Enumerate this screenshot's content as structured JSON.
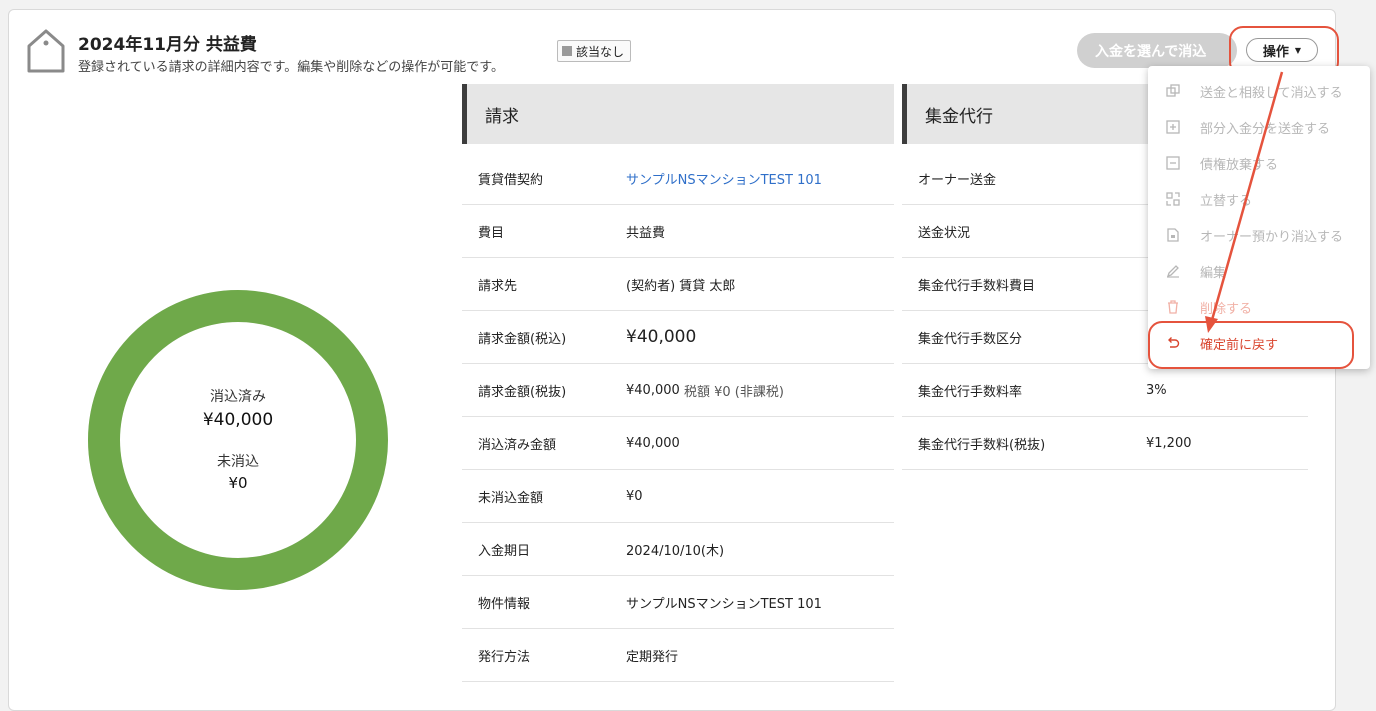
{
  "header": {
    "title": "2024年11月分 共益費",
    "subtitle": "登録されている請求の詳細内容です。編集や削除などの操作が可能です。",
    "badge": "該当なし",
    "pay_button": "入金を選んで消込",
    "operation_button": "操作"
  },
  "menu": {
    "items": [
      {
        "label": "送金と相殺して消込する",
        "icon": "offset-icon"
      },
      {
        "label": "部分入金分を送金する",
        "icon": "plus-square-icon"
      },
      {
        "label": "債権放棄する",
        "icon": "minus-square-icon"
      },
      {
        "label": "立替する",
        "icon": "advance-icon"
      },
      {
        "label": "オーナー預かり消込する",
        "icon": "document-lock-icon"
      },
      {
        "label": "編集",
        "icon": "pencil-icon"
      },
      {
        "label": "削除する",
        "icon": "trash-icon"
      },
      {
        "label": "確定前に戻す",
        "icon": "undo-icon"
      }
    ]
  },
  "summary": {
    "paid_label": "消込済み",
    "paid_value": "¥40,000",
    "unpaid_label": "未消込",
    "unpaid_value": "¥0",
    "paid_fraction": 1.0,
    "colors": {
      "paid": "#6fa94a"
    }
  },
  "billing": {
    "heading": "請求",
    "rows": [
      {
        "label": "賃貸借契約",
        "value": "サンプルNSマンションTEST 101"
      },
      {
        "label": "費目",
        "value": "共益費"
      },
      {
        "label": "請求先",
        "value": "(契約者) 賃貸 太郎"
      },
      {
        "label": "請求金額(税込)",
        "value": "¥40,000"
      },
      {
        "label": "請求金額(税抜)",
        "value": "¥40,000",
        "extra": "税額 ¥0 (非課税)"
      },
      {
        "label": "消込済み金額",
        "value": "¥40,000"
      },
      {
        "label": "未消込金額",
        "value": "¥0"
      },
      {
        "label": "入金期日",
        "value": "2024/10/10(木)"
      },
      {
        "label": "物件情報",
        "value": "サンプルNSマンションTEST 101"
      },
      {
        "label": "発行方法",
        "value": "定期発行"
      }
    ]
  },
  "collection": {
    "heading": "集金代行",
    "rows": [
      {
        "label": "オーナー送金",
        "value": ""
      },
      {
        "label": "送金状況",
        "value": ""
      },
      {
        "label": "集金代行手数料費目",
        "value": ""
      },
      {
        "label": "集金代行手数区分",
        "value": ""
      },
      {
        "label": "集金代行手数料率",
        "value": "3%"
      },
      {
        "label": "集金代行手数料(税抜)",
        "value": "¥1,200"
      }
    ]
  }
}
